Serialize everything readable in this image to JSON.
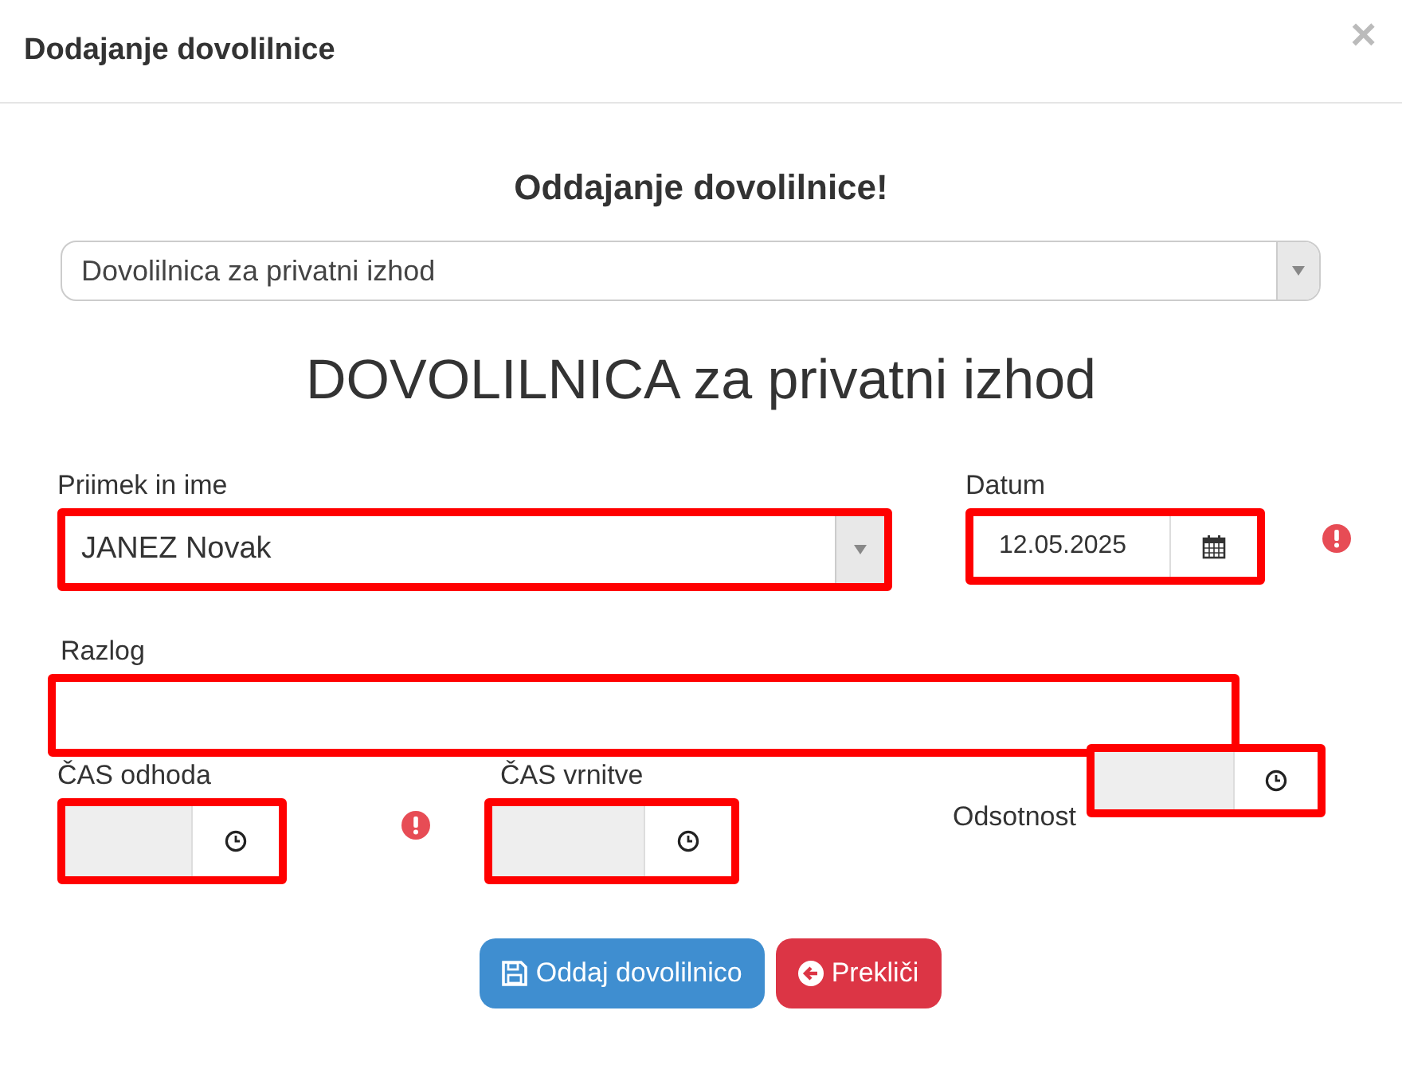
{
  "dialog": {
    "title": "Dodajanje dovolilnice",
    "close": "×"
  },
  "heading": "Oddajanje dovolilnice!",
  "type_select": {
    "value": "Dovolilnica za privatni izhod"
  },
  "form_title": "DOVOLILNICA za privatni izhod",
  "fields": [
    {
      "kind": "select",
      "label": "Priimek in ime",
      "value": "JANEZ Novak",
      "invalid": true,
      "warning": false
    },
    {
      "kind": "date",
      "label": "Datum",
      "value": "12.05.2025",
      "invalid": true,
      "warning": true
    },
    {
      "kind": "text",
      "label": "Razlog",
      "invalid": true,
      "warning": false
    },
    {
      "kind": "time",
      "label": "ČAS odhoda",
      "invalid": true,
      "warning": true
    },
    {
      "kind": "time",
      "label": "ČAS vrnitve",
      "invalid": true,
      "warning": false
    },
    {
      "kind": "time",
      "label": "Odsotnost",
      "invalid": true,
      "warning": false
    }
  ],
  "buttons": [
    {
      "kind": "primary",
      "label": "Oddaj dovolilnico"
    },
    {
      "kind": "danger",
      "label": "Prekliči"
    }
  ]
}
